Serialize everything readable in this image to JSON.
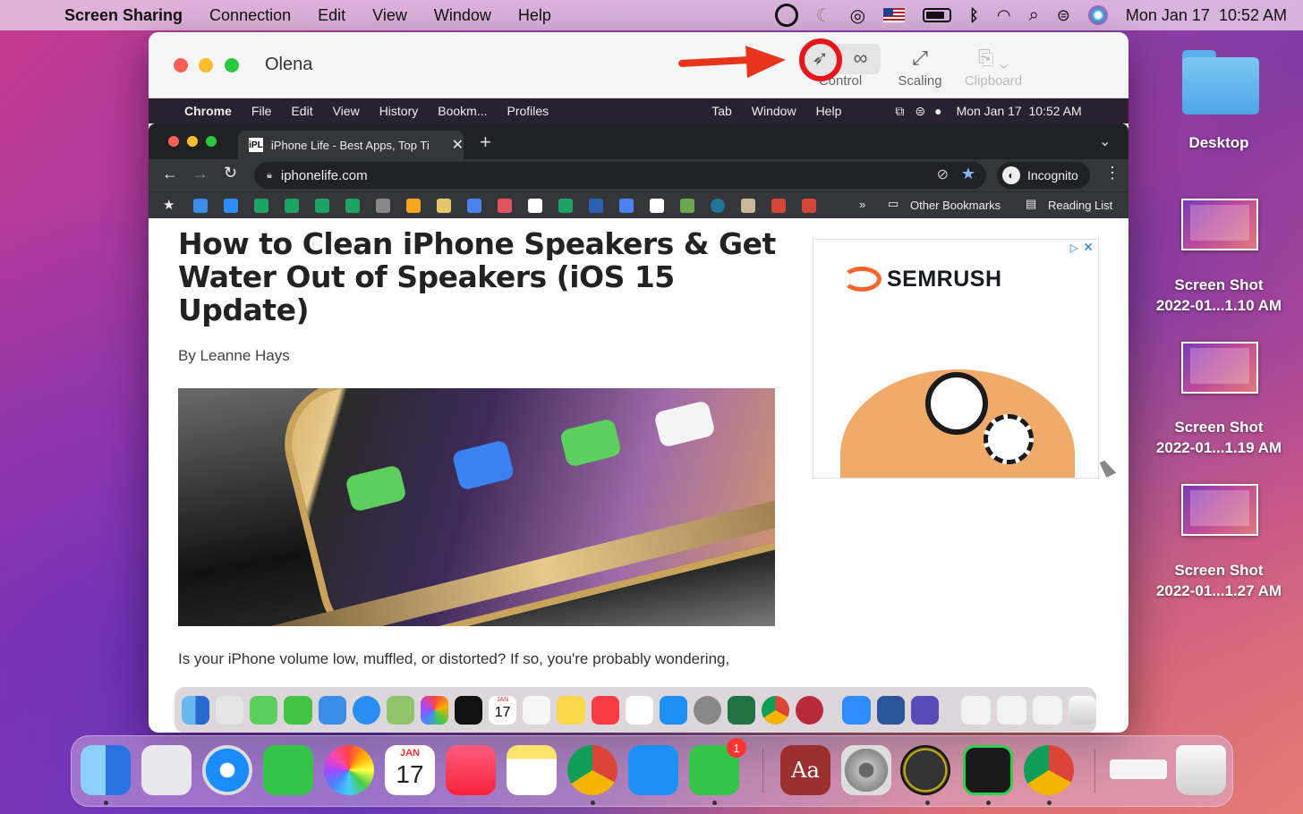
{
  "menubar": {
    "apple": "",
    "items": [
      "Screen Sharing",
      "Connection",
      "Edit",
      "View",
      "Window",
      "Help"
    ],
    "clock": "Mon Jan 17  10:52 AM"
  },
  "window": {
    "title": "Olena",
    "control_label": "Control",
    "scaling_label": "Scaling",
    "clipboard_label": "Clipboard"
  },
  "remote_menubar": {
    "apple": "",
    "items": [
      "Chrome",
      "File",
      "Edit",
      "View",
      "History",
      "Bookm...",
      "Profiles"
    ],
    "right_items": [
      "Tab",
      "Window",
      "Help"
    ],
    "clock": "Mon Jan 17  10:52 AM"
  },
  "chrome": {
    "tab_title": "iPhone Life - Best Apps, Top Ti",
    "favicon": "iPL",
    "url": "iphonelife.com",
    "incognito_label": "Incognito",
    "other_bookmarks": "Other Bookmarks",
    "reading_list": "Reading List",
    "more_bookmarks": "»"
  },
  "article": {
    "headline": "How to Clean iPhone Speakers & Get Water Out of Speakers (iOS 15 Update)",
    "byline": "By Leanne Hays",
    "body": "Is your iPhone volume low, muffled, or distorted? If so, you're probably wondering,"
  },
  "ad": {
    "brand": "SEMRUSH"
  },
  "desktop": {
    "folder_label": "Desktop",
    "files": [
      {
        "line1": "Screen Shot",
        "line2": "2022-01...1.10 AM"
      },
      {
        "line1": "Screen Shot",
        "line2": "2022-01...1.19 AM"
      },
      {
        "line1": "Screen Shot",
        "line2": "2022-01...1.27 AM"
      }
    ]
  },
  "dock": {
    "calendar_month": "JAN",
    "calendar_day": "17",
    "messages_badge": "1",
    "dictionary_label": "Aa"
  },
  "inner_dock": {
    "calendar_day": "17",
    "calendar_month": "JAN"
  },
  "colors": {
    "annotation_red": "#e8141c",
    "chrome_dark": "#202124",
    "chrome_tab": "#35363a"
  }
}
